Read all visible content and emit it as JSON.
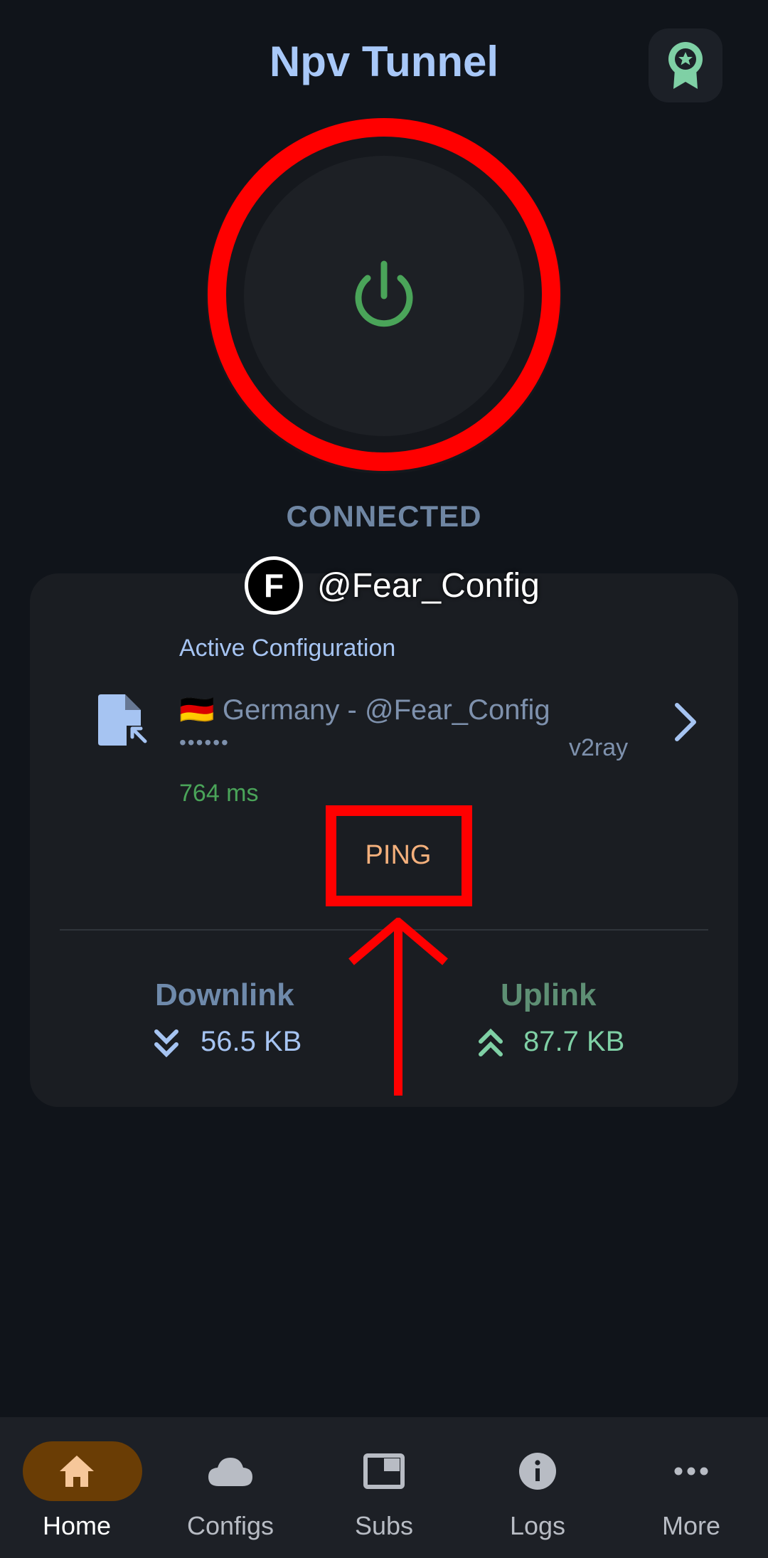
{
  "header": {
    "title": "Npv Tunnel",
    "badge_icon": "award-badge-icon"
  },
  "power": {
    "icon": "power-icon",
    "color": "#4aa459"
  },
  "status": "CONNECTED",
  "watermark": {
    "logo_letter": "F",
    "text": "@Fear_Config"
  },
  "config": {
    "section_label": "Active Configuration",
    "name": "🇩🇪 Germany - @Fear_Config",
    "masked": "••••••",
    "type": "v2ray",
    "latency": "764 ms",
    "ping_label": "PING"
  },
  "traffic": {
    "downlink_label": "Downlink",
    "downlink_value": "56.5 KB",
    "uplink_label": "Uplink",
    "uplink_value": "87.7 KB"
  },
  "nav": {
    "items": [
      {
        "label": "Home",
        "icon": "home-icon",
        "active": true
      },
      {
        "label": "Configs",
        "icon": "cloud-icon",
        "active": false
      },
      {
        "label": "Subs",
        "icon": "subscriptions-icon",
        "active": false
      },
      {
        "label": "Logs",
        "icon": "info-icon",
        "active": false
      },
      {
        "label": "More",
        "icon": "more-icon",
        "active": false
      }
    ]
  },
  "colors": {
    "background": "#10141a",
    "accent": "#a8c8f8",
    "annotation": "#ff0000"
  }
}
